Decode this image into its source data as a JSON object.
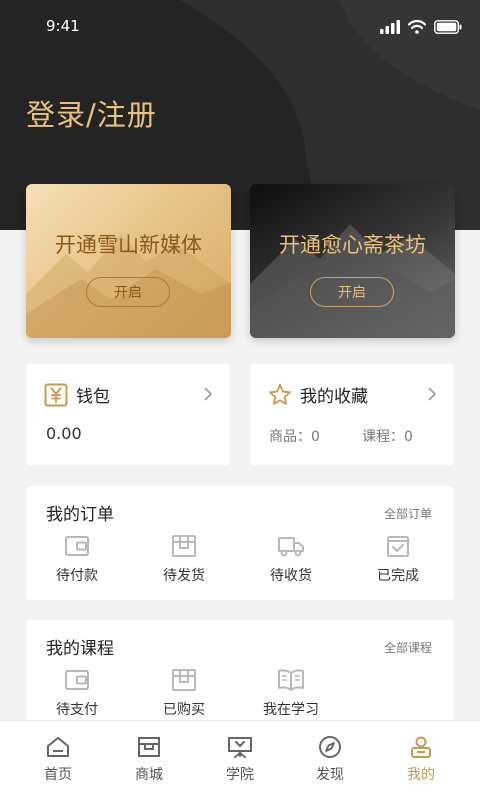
{
  "status": {
    "time": "9:41"
  },
  "header": {
    "login_label": "登录/注册"
  },
  "vip_cards": [
    {
      "title": "开通雪山新媒体",
      "button": "开启"
    },
    {
      "title": "开通愈心斋茶坊",
      "button": "开启"
    }
  ],
  "wallet": {
    "label": "钱包",
    "amount": "0.00"
  },
  "favorites": {
    "label": "我的收藏",
    "goods": "商品：0",
    "courses": "课程：0"
  },
  "orders": {
    "title": "我的订单",
    "link": "全部订单",
    "items": [
      {
        "label": "待付款",
        "icon": "wallet-icon"
      },
      {
        "label": "待发货",
        "icon": "package-icon"
      },
      {
        "label": "待收货",
        "icon": "truck-icon"
      },
      {
        "label": "已完成",
        "icon": "check-box-icon"
      }
    ]
  },
  "courses": {
    "title": "我的课程",
    "link": "全部课程",
    "items": [
      {
        "label": "待支付",
        "icon": "wallet-icon"
      },
      {
        "label": "已购买",
        "icon": "package-icon"
      },
      {
        "label": "我在学习",
        "icon": "book-icon"
      }
    ]
  },
  "tabbar": {
    "active": 4,
    "accent": "#c89a4e",
    "items": [
      {
        "label": "首页",
        "icon": "home-icon"
      },
      {
        "label": "商城",
        "icon": "shop-icon"
      },
      {
        "label": "学院",
        "icon": "lecture-icon"
      },
      {
        "label": "发现",
        "icon": "compass-icon"
      },
      {
        "label": "我的",
        "icon": "user-icon"
      }
    ]
  },
  "colors": {
    "header_bg": "#242424",
    "gold": "#e7c27c",
    "page_bg": "#f3f3f3"
  }
}
